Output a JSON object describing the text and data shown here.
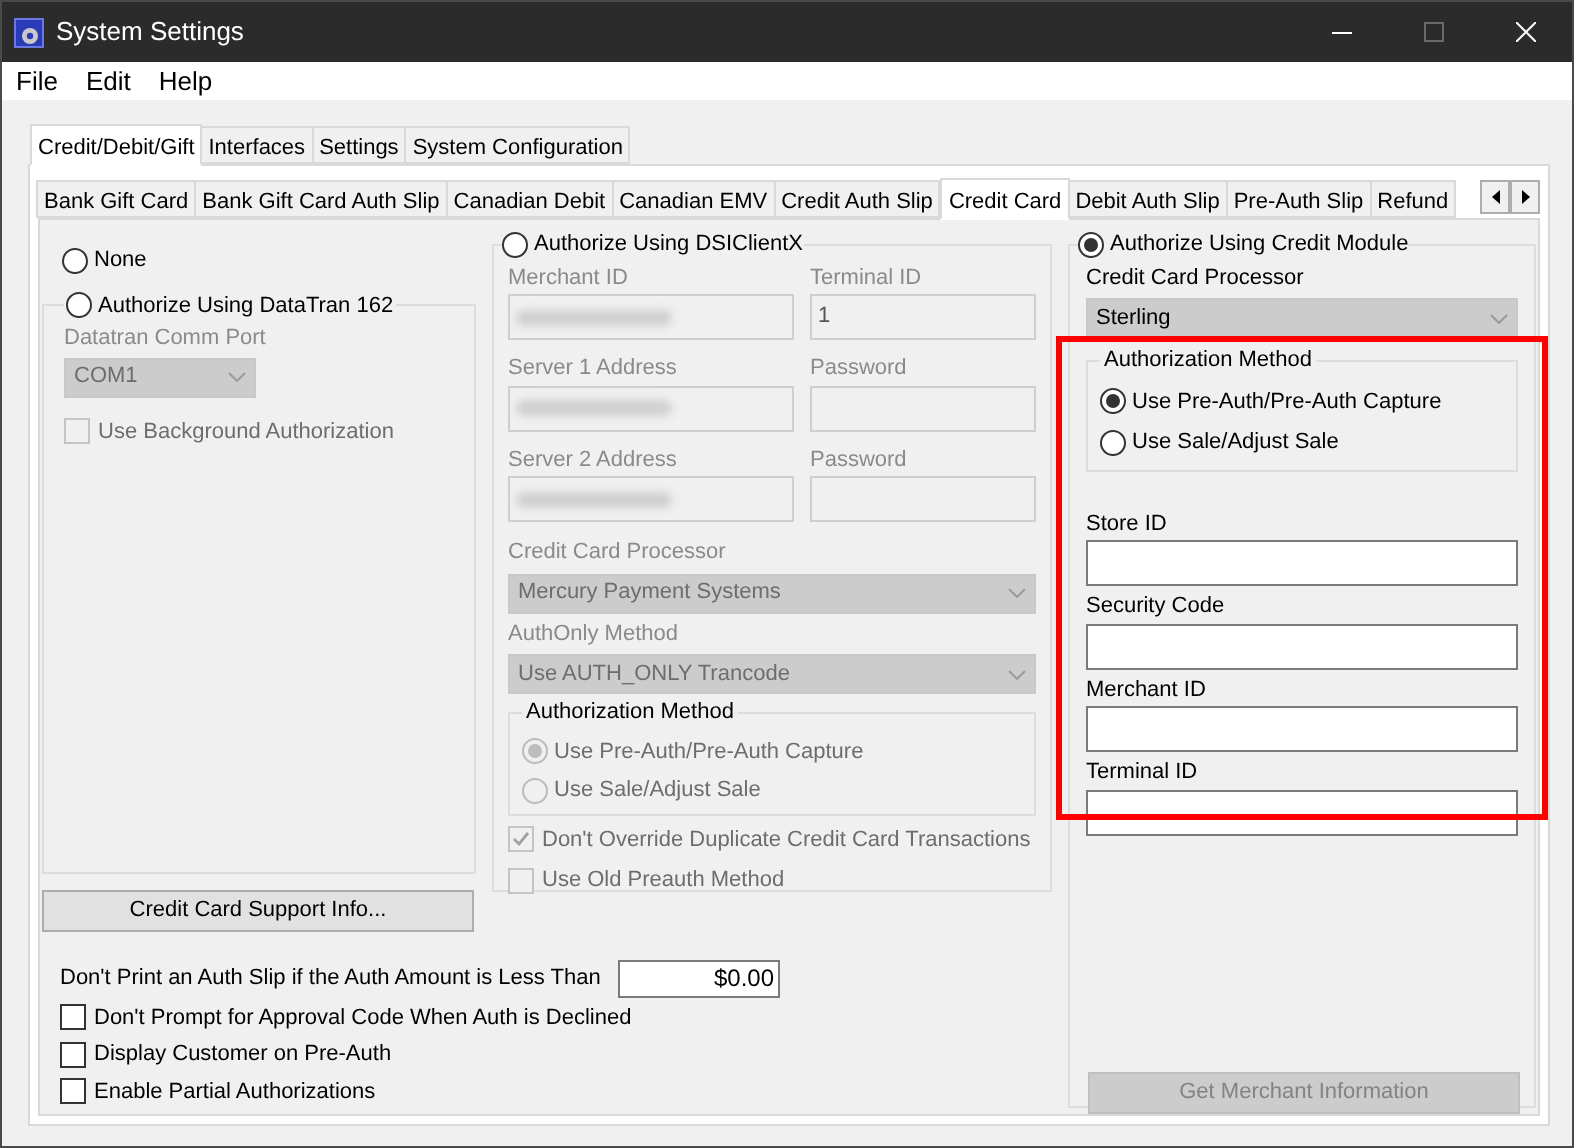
{
  "window": {
    "title": "System Settings"
  },
  "menu": [
    "File",
    "Edit",
    "Help"
  ],
  "outer_tabs": [
    {
      "label": "Credit/Debit/Gift",
      "selected": true
    },
    {
      "label": "Interfaces",
      "selected": false
    },
    {
      "label": "Settings",
      "selected": false
    },
    {
      "label": "System Configuration",
      "selected": false
    }
  ],
  "inner_tabs": [
    {
      "label": "Bank Gift Card",
      "selected": false
    },
    {
      "label": "Bank Gift Card Auth Slip",
      "selected": false
    },
    {
      "label": "Canadian Debit",
      "selected": false
    },
    {
      "label": "Canadian EMV",
      "selected": false
    },
    {
      "label": "Credit Auth Slip",
      "selected": false
    },
    {
      "label": "Credit Card",
      "selected": true
    },
    {
      "label": "Debit Auth Slip",
      "selected": false
    },
    {
      "label": "Pre-Auth Slip",
      "selected": false
    },
    {
      "label": "Refund",
      "selected": false
    }
  ],
  "none_option": {
    "label": "None",
    "selected": false
  },
  "datatran": {
    "label": "Authorize Using DataTran 162",
    "selected": false,
    "disabled": true,
    "comm_port": {
      "label": "Datatran Comm Port",
      "value": "COM1"
    },
    "background_auth": {
      "label": "Use Background Authorization",
      "checked": false
    }
  },
  "dsiclientx": {
    "label": "Authorize Using DSIClientX",
    "selected": false,
    "disabled": true,
    "fields": [
      {
        "label": "Merchant ID",
        "redacted": true
      },
      {
        "label": "Terminal ID",
        "value": "1",
        "redacted": false
      },
      {
        "label": "Server 1 Address",
        "redacted": true
      },
      {
        "label": "Password",
        "redacted": false
      },
      {
        "label": "Server 2 Address",
        "redacted": true
      },
      {
        "label": "Password",
        "redacted": false
      }
    ],
    "processor": {
      "label": "Credit Card Processor",
      "value": "Mercury Payment Systems"
    },
    "authonly": {
      "label": "AuthOnly Method",
      "value": "Use AUTH_ONLY Trancode"
    },
    "auth_method": {
      "title": "Authorization Method",
      "options": [
        {
          "label": "Use Pre-Auth/Pre-Auth Capture",
          "selected": true
        },
        {
          "label": "Use Sale/Adjust Sale",
          "selected": false
        }
      ]
    },
    "checkboxes": [
      {
        "label": "Don't Override Duplicate Credit Card Transactions",
        "checked": true
      },
      {
        "label": "Use Old Preauth Method",
        "checked": false
      }
    ]
  },
  "credit_module": {
    "label": "Authorize Using Credit Module",
    "selected": true,
    "processor": {
      "label": "Credit Card Processor",
      "value": "Sterling"
    },
    "auth_method": {
      "title": "Authorization Method",
      "options": [
        {
          "label": "Use Pre-Auth/Pre-Auth Capture",
          "selected": true
        },
        {
          "label": "Use Sale/Adjust Sale",
          "selected": false
        }
      ]
    },
    "fields": [
      {
        "label": "Store ID"
      },
      {
        "label": "Security Code"
      },
      {
        "label": "Merchant ID"
      },
      {
        "label": "Terminal ID"
      }
    ],
    "merchant_button": {
      "label": "Get Merchant Information",
      "disabled": true
    }
  },
  "support_button": "Credit Card Support Info...",
  "min_amount": {
    "label": "Don't Print an Auth Slip if the Auth Amount is Less Than",
    "value": "$0.00"
  },
  "options": [
    {
      "label": "Don't Prompt for Approval Code When Auth is Declined",
      "checked": false
    },
    {
      "label": "Display Customer on Pre-Auth",
      "checked": false
    },
    {
      "label": "Enable Partial Authorizations",
      "checked": false
    }
  ]
}
